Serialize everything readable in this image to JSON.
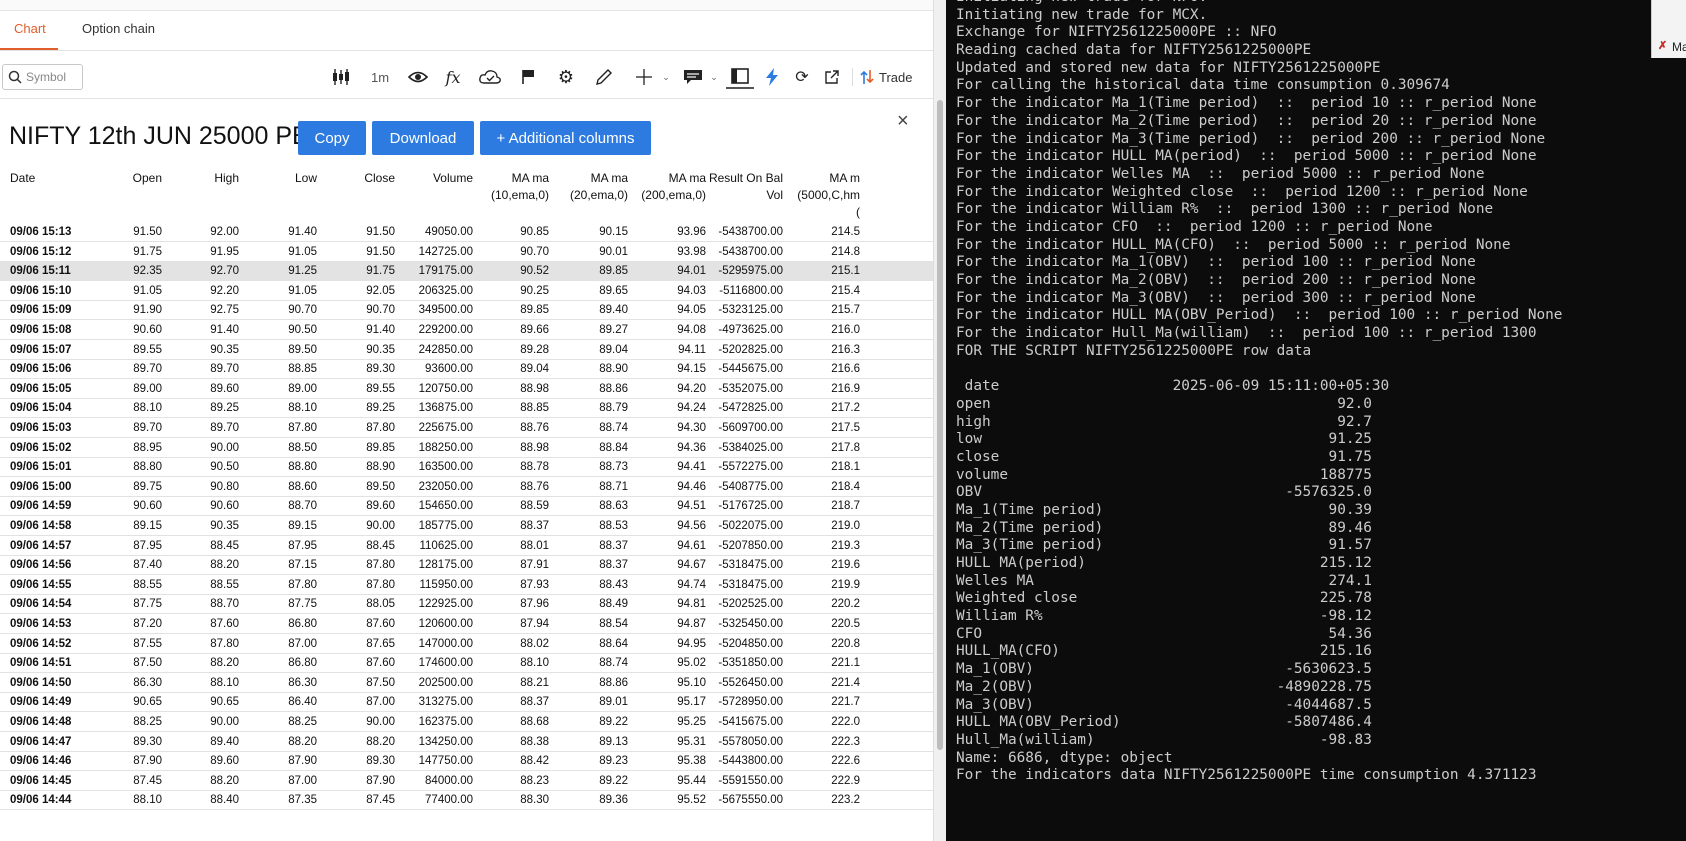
{
  "tabs": [
    {
      "label": "Chart",
      "active": true
    },
    {
      "label": "Option chain",
      "active": false
    }
  ],
  "toolbar": {
    "search_placeholder": "Symbol",
    "interval": "1m",
    "trade_label": "Trade",
    "icons": [
      "candles-icon",
      "eye-icon",
      "fx-icon",
      "alert-icon",
      "flag-icon",
      "gear-icon",
      "pencil-icon",
      "crosshair-icon",
      "chat-icon",
      "table-icon",
      "bolt-icon",
      "refresh-icon",
      "popout-icon",
      "trade-icon"
    ]
  },
  "modal": {
    "title": "NIFTY 12th JUN 25000 PE",
    "buttons": {
      "copy": "Copy",
      "download": "Download",
      "additional": "+ Additional columns"
    },
    "close": "×",
    "columns": [
      {
        "l1": "Date",
        "l2": "",
        "l3": ""
      },
      {
        "l1": "Open",
        "l2": "",
        "l3": ""
      },
      {
        "l1": "High",
        "l2": "",
        "l3": ""
      },
      {
        "l1": "Low",
        "l2": "",
        "l3": ""
      },
      {
        "l1": "Close",
        "l2": "",
        "l3": ""
      },
      {
        "l1": "Volume",
        "l2": "",
        "l3": ""
      },
      {
        "l1": "MA ma",
        "l2": "(10,ema,0)",
        "l3": ""
      },
      {
        "l1": "MA ma",
        "l2": "(20,ema,0)",
        "l3": ""
      },
      {
        "l1": "MA ma",
        "l2": "(200,ema,0)",
        "l3": ""
      },
      {
        "l1": "Result On Bal",
        "l2": "Vol",
        "l3": ""
      },
      {
        "l1": "MA m",
        "l2": "(5000,C,hm",
        "l3": "("
      }
    ],
    "selected_row": 2,
    "rows": [
      [
        "09/06 15:13",
        "91.50",
        "92.00",
        "91.40",
        "91.50",
        "49050.00",
        "90.85",
        "90.15",
        "93.96",
        "-5438700.00",
        "214.5"
      ],
      [
        "09/06 15:12",
        "91.75",
        "91.95",
        "91.05",
        "91.50",
        "142725.00",
        "90.70",
        "90.01",
        "93.98",
        "-5438700.00",
        "214.8"
      ],
      [
        "09/06 15:11",
        "92.35",
        "92.70",
        "91.25",
        "91.75",
        "179175.00",
        "90.52",
        "89.85",
        "94.01",
        "-5295975.00",
        "215.1"
      ],
      [
        "09/06 15:10",
        "91.05",
        "92.20",
        "91.05",
        "92.05",
        "206325.00",
        "90.25",
        "89.65",
        "94.03",
        "-5116800.00",
        "215.4"
      ],
      [
        "09/06 15:09",
        "91.90",
        "92.75",
        "90.70",
        "90.70",
        "349500.00",
        "89.85",
        "89.40",
        "94.05",
        "-5323125.00",
        "215.7"
      ],
      [
        "09/06 15:08",
        "90.60",
        "91.40",
        "90.50",
        "91.40",
        "229200.00",
        "89.66",
        "89.27",
        "94.08",
        "-4973625.00",
        "216.0"
      ],
      [
        "09/06 15:07",
        "89.55",
        "90.35",
        "89.50",
        "90.35",
        "242850.00",
        "89.28",
        "89.04",
        "94.11",
        "-5202825.00",
        "216.3"
      ],
      [
        "09/06 15:06",
        "89.70",
        "89.70",
        "88.85",
        "89.30",
        "93600.00",
        "89.04",
        "88.90",
        "94.15",
        "-5445675.00",
        "216.6"
      ],
      [
        "09/06 15:05",
        "89.00",
        "89.60",
        "89.00",
        "89.55",
        "120750.00",
        "88.98",
        "88.86",
        "94.20",
        "-5352075.00",
        "216.9"
      ],
      [
        "09/06 15:04",
        "88.10",
        "89.25",
        "88.10",
        "89.25",
        "136875.00",
        "88.85",
        "88.79",
        "94.24",
        "-5472825.00",
        "217.2"
      ],
      [
        "09/06 15:03",
        "89.70",
        "89.70",
        "87.80",
        "87.80",
        "225675.00",
        "88.76",
        "88.74",
        "94.30",
        "-5609700.00",
        "217.5"
      ],
      [
        "09/06 15:02",
        "88.95",
        "90.00",
        "88.50",
        "89.85",
        "188250.00",
        "88.98",
        "88.84",
        "94.36",
        "-5384025.00",
        "217.8"
      ],
      [
        "09/06 15:01",
        "88.80",
        "90.50",
        "88.80",
        "88.90",
        "163500.00",
        "88.78",
        "88.73",
        "94.41",
        "-5572275.00",
        "218.1"
      ],
      [
        "09/06 15:00",
        "89.75",
        "90.80",
        "88.60",
        "89.50",
        "232050.00",
        "88.76",
        "88.71",
        "94.46",
        "-5408775.00",
        "218.4"
      ],
      [
        "09/06 14:59",
        "90.60",
        "90.60",
        "88.70",
        "89.60",
        "154650.00",
        "88.59",
        "88.63",
        "94.51",
        "-5176725.00",
        "218.7"
      ],
      [
        "09/06 14:58",
        "89.15",
        "90.35",
        "89.15",
        "90.00",
        "185775.00",
        "88.37",
        "88.53",
        "94.56",
        "-5022075.00",
        "219.0"
      ],
      [
        "09/06 14:57",
        "87.95",
        "88.45",
        "87.95",
        "88.45",
        "110625.00",
        "88.01",
        "88.37",
        "94.61",
        "-5207850.00",
        "219.3"
      ],
      [
        "09/06 14:56",
        "87.40",
        "88.20",
        "87.15",
        "87.80",
        "128175.00",
        "87.91",
        "88.37",
        "94.67",
        "-5318475.00",
        "219.6"
      ],
      [
        "09/06 14:55",
        "88.55",
        "88.55",
        "87.80",
        "87.80",
        "115950.00",
        "87.93",
        "88.43",
        "94.74",
        "-5318475.00",
        "219.9"
      ],
      [
        "09/06 14:54",
        "87.75",
        "88.70",
        "87.75",
        "88.05",
        "122925.00",
        "87.96",
        "88.49",
        "94.81",
        "-5202525.00",
        "220.2"
      ],
      [
        "09/06 14:53",
        "87.20",
        "87.60",
        "86.80",
        "87.60",
        "120600.00",
        "87.94",
        "88.54",
        "94.87",
        "-5325450.00",
        "220.5"
      ],
      [
        "09/06 14:52",
        "87.55",
        "87.80",
        "87.00",
        "87.65",
        "147000.00",
        "88.02",
        "88.64",
        "94.95",
        "-5204850.00",
        "220.8"
      ],
      [
        "09/06 14:51",
        "87.50",
        "88.20",
        "86.80",
        "87.60",
        "174600.00",
        "88.10",
        "88.74",
        "95.02",
        "-5351850.00",
        "221.1"
      ],
      [
        "09/06 14:50",
        "86.30",
        "88.10",
        "86.30",
        "87.50",
        "202500.00",
        "88.21",
        "88.86",
        "95.10",
        "-5526450.00",
        "221.4"
      ],
      [
        "09/06 14:49",
        "90.65",
        "90.65",
        "86.40",
        "87.00",
        "313275.00",
        "88.37",
        "89.01",
        "95.17",
        "-5728950.00",
        "221.7"
      ],
      [
        "09/06 14:48",
        "88.25",
        "90.00",
        "88.25",
        "90.00",
        "162375.00",
        "88.68",
        "89.22",
        "95.25",
        "-5415675.00",
        "222.0"
      ],
      [
        "09/06 14:47",
        "89.30",
        "89.40",
        "88.20",
        "88.20",
        "134250.00",
        "88.38",
        "89.13",
        "95.31",
        "-5578050.00",
        "222.3"
      ],
      [
        "09/06 14:46",
        "87.90",
        "89.60",
        "87.90",
        "89.30",
        "147750.00",
        "88.42",
        "89.23",
        "95.38",
        "-5443800.00",
        "222.6"
      ],
      [
        "09/06 14:45",
        "87.45",
        "88.20",
        "87.00",
        "87.90",
        "84000.00",
        "88.23",
        "89.22",
        "95.44",
        "-5591550.00",
        "222.9"
      ],
      [
        "09/06 14:44",
        "88.10",
        "88.40",
        "87.35",
        "87.45",
        "77400.00",
        "88.30",
        "89.36",
        "95.52",
        "-5675550.00",
        "223.2"
      ]
    ]
  },
  "terminal": {
    "lines": [
      "Initiating new trade for NFO.",
      "Initiating new trade for MCX.",
      "Exchange for NIFTY2561225000PE :: NFO",
      "Reading cached data for NIFTY2561225000PE",
      "Updated and stored new data for NIFTY2561225000PE",
      "For calling the historical data time consumption 0.309674",
      "For the indicator Ma_1(Time period)  ::  period 10 :: r_period None",
      "For the indicator Ma_2(Time period)  ::  period 20 :: r_period None",
      "For the indicator Ma_3(Time period)  ::  period 200 :: r_period None",
      "For the indicator HULL MA(period)  ::  period 5000 :: r_period None",
      "For the indicator Welles MA  ::  period 5000 :: r_period None",
      "For the indicator Weighted close  ::  period 1200 :: r_period None",
      "For the indicator William R%  ::  period 1300 :: r_period None",
      "For the indicator CFO  ::  period 1200 :: r_period None",
      "For the indicator HULL_MA(CFO)  ::  period 5000 :: r_period None",
      "For the indicator Ma_1(OBV)  ::  period 100 :: r_period None",
      "For the indicator Ma_2(OBV)  ::  period 200 :: r_period None",
      "For the indicator Ma_3(OBV)  ::  period 300 :: r_period None",
      "For the indicator HULL MA(OBV_Period)  ::  period 100 :: r_period None",
      "For the indicator Hull_Ma(william)  ::  period 100 :: r_period 1300",
      "FOR THE SCRIPT NIFTY2561225000PE row data",
      "",
      " date                    2025-06-09 15:11:00+05:30",
      "open                                        92.0",
      "high                                        92.7",
      "low                                        91.25",
      "close                                      91.75",
      "volume                                    188775",
      "OBV                                   -5576325.0",
      "Ma_1(Time period)                          90.39",
      "Ma_2(Time period)                          89.46",
      "Ma_3(Time period)                          91.57",
      "HULL MA(period)                           215.12",
      "Welles MA                                  274.1",
      "Weighted close                            225.78",
      "William R%                                -98.12",
      "CFO                                        54.36",
      "HULL_MA(CFO)                              215.16",
      "Ma_1(OBV)                             -5630623.5",
      "Ma_2(OBV)                            -4890228.75",
      "Ma_3(OBV)                             -4044687.5",
      "HULL MA(OBV_Period)                   -5807486.4",
      "Hull_Ma(william)                          -98.83",
      "Name: 6686, dtype: object",
      "For the indicators data NIFTY2561225000PE time consumption 4.371123"
    ],
    "badge_text": "Ma"
  },
  "colors": {
    "accent": "#e25d2c",
    "button": "#2d7be0",
    "terminal_bg": "#0c0c0c",
    "terminal_fg": "#cccccc",
    "selected_row": "#e3e3e3"
  }
}
